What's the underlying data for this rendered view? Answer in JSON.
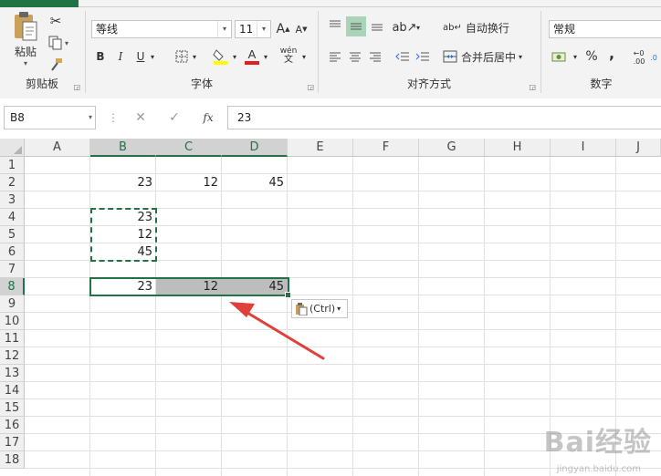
{
  "ribbon": {
    "clipboard": {
      "paste_label": "粘贴",
      "group_label": "剪贴板"
    },
    "font": {
      "font_name": "等线",
      "font_size": "11",
      "group_label": "字体",
      "bold": "B",
      "italic": "I",
      "underline": "U",
      "grow": "A",
      "shrink": "A",
      "phonetic": "wén"
    },
    "alignment": {
      "wrap_label": "自动换行",
      "merge_label": "合并后居中",
      "group_label": "对齐方式"
    },
    "number": {
      "format": "常规",
      "percent": "%",
      "comma": ",",
      "group_label": "数字"
    }
  },
  "formula_bar": {
    "name_box": "B8",
    "fx": "fx",
    "value": "23"
  },
  "columns": [
    "A",
    "B",
    "C",
    "D",
    "E",
    "F",
    "G",
    "H",
    "I",
    "J"
  ],
  "rows": [
    "1",
    "2",
    "3",
    "4",
    "5",
    "6",
    "7",
    "8",
    "9",
    "10",
    "11",
    "12",
    "13",
    "14",
    "15",
    "16",
    "17",
    "18"
  ],
  "cells": {
    "B2": "23",
    "C2": "12",
    "D2": "45",
    "B4": "23",
    "B5": "12",
    "B6": "45",
    "B8": "23",
    "C8": "12",
    "D8": "45"
  },
  "paste_options": {
    "label": "(Ctrl)"
  },
  "watermark": {
    "brand": "Bai经验",
    "url": "jingyan.baidu.com"
  },
  "colors": {
    "accent": "#217346",
    "arrow": "#e0403a",
    "selection_fill": "#bdbdbd"
  }
}
